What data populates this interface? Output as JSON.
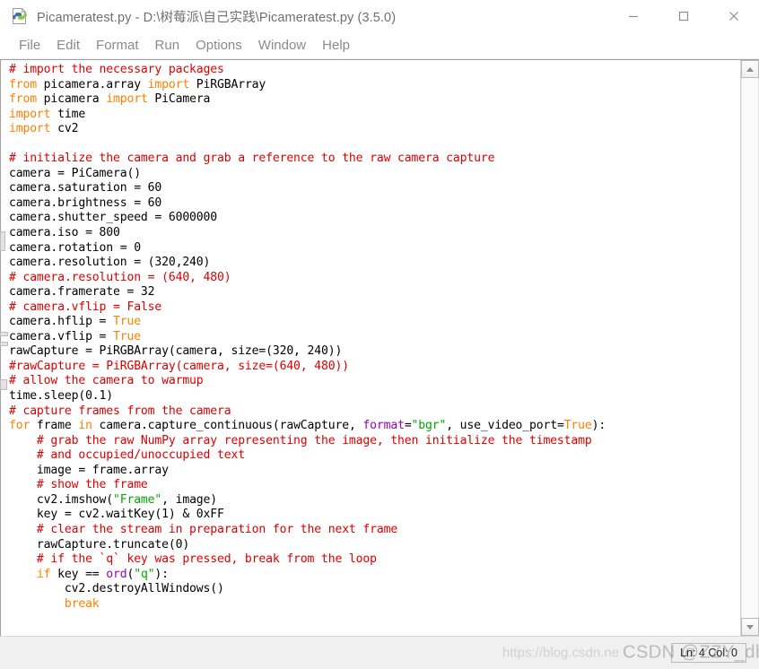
{
  "window": {
    "title": "Picameratest.py - D:\\树莓派\\自己实践\\Picameratest.py (3.5.0)",
    "icon": "python-file-icon",
    "controls": {
      "minimize": "minimize-icon",
      "maximize": "maximize-icon",
      "close": "close-icon"
    }
  },
  "menubar": {
    "items": [
      {
        "label": "File"
      },
      {
        "label": "Edit"
      },
      {
        "label": "Format"
      },
      {
        "label": "Run"
      },
      {
        "label": "Options"
      },
      {
        "label": "Window"
      },
      {
        "label": "Help"
      }
    ]
  },
  "colors": {
    "comment": "#dd0000",
    "keyword": "#ff8000",
    "string": "#00aa00",
    "builtin": "#9900bb",
    "text": "#000000",
    "background": "#ffffff",
    "titlebar_text": "#6f6f6f",
    "menu_text": "#8a8a8a",
    "statusbar_bg": "#f0f0f0"
  },
  "editor": {
    "language": "python",
    "lines": [
      [
        {
          "t": "# import the necessary packages",
          "c": "cmt"
        }
      ],
      [
        {
          "t": "from",
          "c": "kw"
        },
        {
          "t": " picamera.array ",
          "c": "plain"
        },
        {
          "t": "import",
          "c": "kw"
        },
        {
          "t": " PiRGBArray",
          "c": "plain"
        }
      ],
      [
        {
          "t": "from",
          "c": "kw"
        },
        {
          "t": " picamera ",
          "c": "plain"
        },
        {
          "t": "import",
          "c": "kw"
        },
        {
          "t": " PiCamera",
          "c": "plain"
        }
      ],
      [
        {
          "t": "import",
          "c": "kw"
        },
        {
          "t": " time",
          "c": "plain"
        }
      ],
      [
        {
          "t": "import",
          "c": "kw"
        },
        {
          "t": " cv2",
          "c": "plain"
        }
      ],
      [],
      [
        {
          "t": "# initialize the camera and grab a reference to the raw camera capture",
          "c": "cmt"
        }
      ],
      [
        {
          "t": "camera = PiCamera()",
          "c": "plain"
        }
      ],
      [
        {
          "t": "camera.saturation = 60",
          "c": "plain"
        }
      ],
      [
        {
          "t": "camera.brightness = 60",
          "c": "plain"
        }
      ],
      [
        {
          "t": "camera.shutter_speed = 6000000",
          "c": "plain"
        }
      ],
      [
        {
          "t": "camera.iso = 800",
          "c": "plain"
        }
      ],
      [
        {
          "t": "camera.rotation = 0",
          "c": "plain"
        }
      ],
      [
        {
          "t": "camera.resolution = (320,240)",
          "c": "plain"
        }
      ],
      [
        {
          "t": "# camera.resolution = (640, 480)",
          "c": "cmt"
        }
      ],
      [
        {
          "t": "camera.framerate = 32",
          "c": "plain"
        }
      ],
      [
        {
          "t": "# camera.vflip = False",
          "c": "cmt"
        }
      ],
      [
        {
          "t": "camera.hflip = ",
          "c": "plain"
        },
        {
          "t": "True",
          "c": "kw"
        }
      ],
      [
        {
          "t": "camera.vflip = ",
          "c": "plain"
        },
        {
          "t": "True",
          "c": "kw"
        }
      ],
      [
        {
          "t": "rawCapture = PiRGBArray(camera, size=(320, 240))",
          "c": "plain"
        }
      ],
      [
        {
          "t": "#rawCapture = PiRGBArray(camera, size=(640, 480))",
          "c": "cmt"
        }
      ],
      [
        {
          "t": "# allow the camera to warmup",
          "c": "cmt"
        }
      ],
      [
        {
          "t": "time.sleep(0.1)",
          "c": "plain"
        }
      ],
      [
        {
          "t": "# capture frames from the camera",
          "c": "cmt"
        }
      ],
      [
        {
          "t": "for",
          "c": "kw"
        },
        {
          "t": " frame ",
          "c": "plain"
        },
        {
          "t": "in",
          "c": "kw"
        },
        {
          "t": " camera.capture_continuous(rawCapture, ",
          "c": "plain"
        },
        {
          "t": "format",
          "c": "bif"
        },
        {
          "t": "=",
          "c": "plain"
        },
        {
          "t": "\"bgr\"",
          "c": "str"
        },
        {
          "t": ", use_video_port=",
          "c": "plain"
        },
        {
          "t": "True",
          "c": "kw"
        },
        {
          "t": "):",
          "c": "plain"
        }
      ],
      [
        {
          "t": "    # grab the raw NumPy array representing the image, then initialize the timestamp",
          "c": "cmt"
        }
      ],
      [
        {
          "t": "    # and occupied/unoccupied text",
          "c": "cmt"
        }
      ],
      [
        {
          "t": "    image = frame.array",
          "c": "plain"
        }
      ],
      [
        {
          "t": "    # show the frame",
          "c": "cmt"
        }
      ],
      [
        {
          "t": "    cv2.imshow(",
          "c": "plain"
        },
        {
          "t": "\"Frame\"",
          "c": "str"
        },
        {
          "t": ", image)",
          "c": "plain"
        }
      ],
      [
        {
          "t": "    key = cv2.waitKey(1) & 0xFF",
          "c": "plain"
        }
      ],
      [
        {
          "t": "    # clear the stream in preparation for the next frame",
          "c": "cmt"
        }
      ],
      [
        {
          "t": "    rawCapture.truncate(0)",
          "c": "plain"
        }
      ],
      [
        {
          "t": "    # if the `q` key was pressed, break from the loop",
          "c": "cmt"
        }
      ],
      [
        {
          "t": "    ",
          "c": "plain"
        },
        {
          "t": "if",
          "c": "kw"
        },
        {
          "t": " key == ",
          "c": "plain"
        },
        {
          "t": "ord",
          "c": "bif"
        },
        {
          "t": "(",
          "c": "plain"
        },
        {
          "t": "\"q\"",
          "c": "str"
        },
        {
          "t": "):",
          "c": "plain"
        }
      ],
      [
        {
          "t": "        cv2.destroyAllWindows()",
          "c": "plain"
        }
      ],
      [
        {
          "t": "        ",
          "c": "plain"
        },
        {
          "t": "break",
          "c": "kw"
        }
      ]
    ]
  },
  "scrollbar": {
    "up_arrow": "scroll-up-icon",
    "down_arrow": "scroll-down-icon"
  },
  "statusbar": {
    "position": "Ln: 4 Col: 0"
  },
  "watermarks": {
    "url": "https://blog.csdn.ne",
    "brand": "CSDN @ZZY_db"
  }
}
